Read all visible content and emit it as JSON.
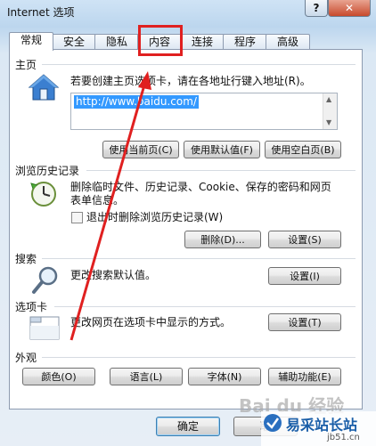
{
  "window": {
    "title": "Internet 选项",
    "help_label": "?",
    "close_label": "✕"
  },
  "tabs": [
    {
      "label": "常规"
    },
    {
      "label": "安全"
    },
    {
      "label": "隐私"
    },
    {
      "label": "内容"
    },
    {
      "label": "连接"
    },
    {
      "label": "程序"
    },
    {
      "label": "高级"
    }
  ],
  "home": {
    "heading": "主页",
    "description": "若要创建主页选项卡，请在各地址行键入地址(R)。",
    "url": "http://www.baidu.com/",
    "btn_current": "使用当前页(C)",
    "btn_default": "使用默认值(F)",
    "btn_blank": "使用空白页(B)"
  },
  "history": {
    "heading": "浏览历史记录",
    "description_line1": "删除临时文件、历史记录、Cookie、保存的密码和网页",
    "description_line2": "表单信息。",
    "checkbox_label": "退出时删除浏览历史记录(W)",
    "btn_delete": "删除(D)...",
    "btn_settings": "设置(S)"
  },
  "search": {
    "heading": "搜索",
    "description": "更改搜索默认值。",
    "btn_settings": "设置(I)"
  },
  "tabs_section": {
    "heading": "选项卡",
    "description": "更改网页在选项卡中显示的方式。",
    "btn_settings": "设置(T)"
  },
  "appearance": {
    "heading": "外观",
    "btn_colors": "颜色(O)",
    "btn_languages": "语言(L)",
    "btn_fonts": "字体(N)",
    "btn_accessibility": "辅助功能(E)"
  },
  "footer": {
    "ok": "确定",
    "cancel": "取"
  },
  "watermark": {
    "baidu": "Bai du 经验",
    "site": "易采站长站",
    "site_url": "jb51.cn"
  },
  "colors": {
    "annotation_red": "#e02020",
    "selection_blue": "#3399ff"
  },
  "icons": {
    "home": "house-icon",
    "history": "clock-icon",
    "search": "magnifier-icon",
    "tabs": "window-icon"
  }
}
